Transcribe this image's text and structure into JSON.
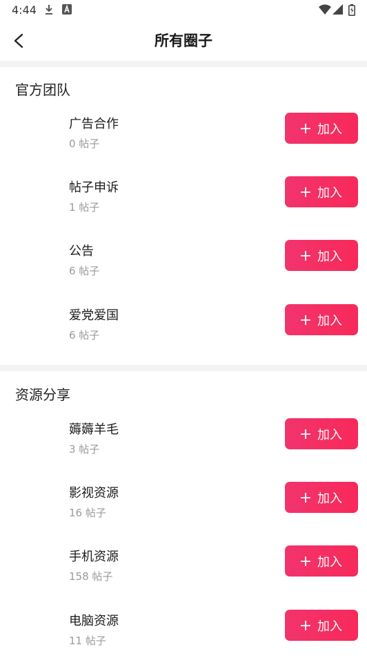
{
  "status_bar": {
    "time": "4:44",
    "icons": [
      "download-icon",
      "a-icon",
      "wifi-icon",
      "signal-icon",
      "battery-icon"
    ]
  },
  "header": {
    "title": "所有圈子",
    "back_icon": "back-arrow-icon"
  },
  "sections": [
    {
      "title": "官方团队",
      "items": [
        {
          "name": "广告合作",
          "count": "0 帖子",
          "button_label": "加入"
        },
        {
          "name": "帖子申诉",
          "count": "1 帖子",
          "button_label": "加入"
        },
        {
          "name": "公告",
          "count": "6 帖子",
          "button_label": "加入"
        },
        {
          "name": "爱党爱国",
          "count": "6 帖子",
          "button_label": "加入"
        }
      ]
    },
    {
      "title": "资源分享",
      "items": [
        {
          "name": "薅薅羊毛",
          "count": "3 帖子",
          "button_label": "加入"
        },
        {
          "name": "影视资源",
          "count": "16 帖子",
          "button_label": "加入"
        },
        {
          "name": "手机资源",
          "count": "158 帖子",
          "button_label": "加入"
        },
        {
          "name": "电脑资源",
          "count": "11 帖子",
          "button_label": "加入"
        }
      ]
    }
  ],
  "colors": {
    "accent": "#f52f62",
    "divider": "#f3f3f3",
    "muted_text": "#9a9a9a"
  }
}
